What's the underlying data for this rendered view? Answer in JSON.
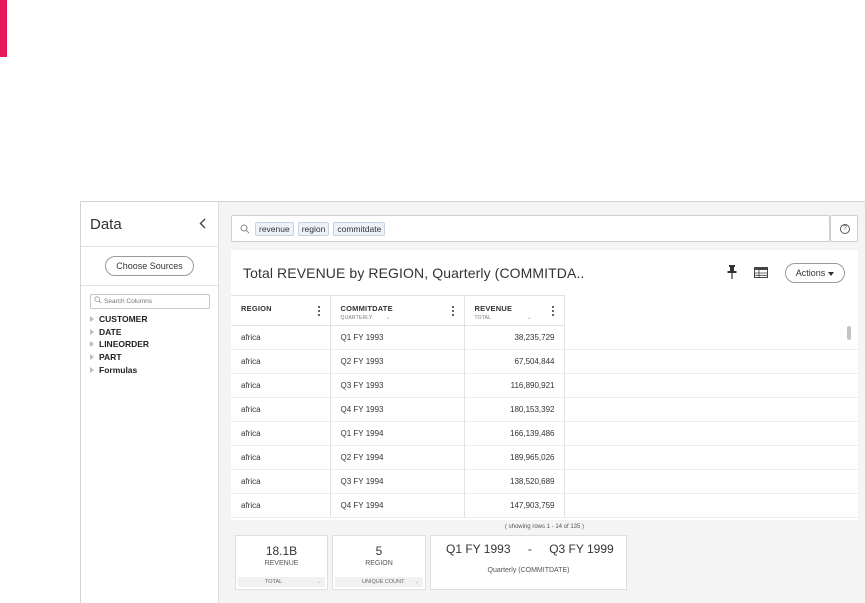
{
  "colors": {
    "accent": "#e8195a"
  },
  "sidebar": {
    "title": "Data",
    "collapse_icon": "chevron-left-icon",
    "choose_sources_label": "Choose Sources",
    "search_placeholder": "Search Columns",
    "tree": [
      {
        "label": "CUSTOMER"
      },
      {
        "label": "DATE"
      },
      {
        "label": "LINEORDER"
      },
      {
        "label": "PART"
      },
      {
        "label": "Formulas"
      }
    ]
  },
  "search": {
    "tokens": [
      "revenue",
      "region",
      "commitdate"
    ],
    "help_label": "?"
  },
  "answer": {
    "title": "Total REVENUE by REGION, Quarterly (COMMITDA..",
    "actions_label": "Actions",
    "columns": [
      {
        "label": "REGION",
        "sub": ""
      },
      {
        "label": "COMMITDATE",
        "sub": "QUARTERLY"
      },
      {
        "label": "REVENUE",
        "sub": "TOTAL"
      }
    ],
    "rows": [
      [
        "africa",
        "Q1 FY 1993",
        "38,235,729"
      ],
      [
        "africa",
        "Q2 FY 1993",
        "67,504,844"
      ],
      [
        "africa",
        "Q3 FY 1993",
        "116,890,921"
      ],
      [
        "africa",
        "Q4 FY 1993",
        "180,153,392"
      ],
      [
        "africa",
        "Q1 FY 1994",
        "166,139,486"
      ],
      [
        "africa",
        "Q2 FY 1994",
        "189,965,026"
      ],
      [
        "africa",
        "Q3 FY 1994",
        "138,520,689"
      ],
      [
        "africa",
        "Q4 FY 1994",
        "147,903,759"
      ]
    ],
    "row_status": "( showing rows 1 - 14 of 135 )"
  },
  "summary": [
    {
      "value": "18.1B",
      "label": "REVENUE",
      "footer": "TOTAL"
    },
    {
      "value": "5",
      "label": "REGION",
      "footer": "UNIQUE COUNT"
    }
  ],
  "range": {
    "start": "Q1 FY 1993",
    "separator": "-",
    "end": "Q3 FY 1999",
    "label": "Quarterly (COMMITDATE)"
  }
}
